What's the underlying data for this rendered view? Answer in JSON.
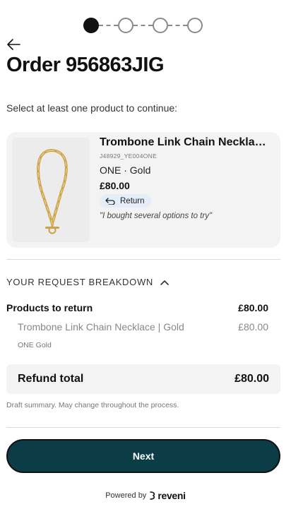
{
  "stepper": {
    "total_steps": 4,
    "current_step": 1
  },
  "order": {
    "title": "Order 956863JIG"
  },
  "instruction": "Select at least one product to continue:",
  "product": {
    "title": "Trombone Link Chain Necklace | Gold",
    "sku": "J48929_YE004ONE",
    "variant": "ONE · Gold",
    "price": "£80.00",
    "badge_label": "Return",
    "reason": "\"I bought several options to try\""
  },
  "breakdown": {
    "heading": "YOUR REQUEST BREAKDOWN",
    "products_label": "Products to return",
    "products_total": "£80.00",
    "item_name": "Trombone Link Chain Necklace | Gold",
    "item_price": "£80.00",
    "item_variant": "ONE Gold",
    "refund_label": "Refund total",
    "refund_amount": "£80.00",
    "note": "Draft summary. May change throughout the process."
  },
  "next_label": "Next",
  "footer": {
    "powered_by": "Powered by",
    "brand": "reveni"
  },
  "colors": {
    "button_bg": "#0c3d47",
    "card_bg": "#f3f3f3",
    "badge_bg": "#e3eef8"
  }
}
